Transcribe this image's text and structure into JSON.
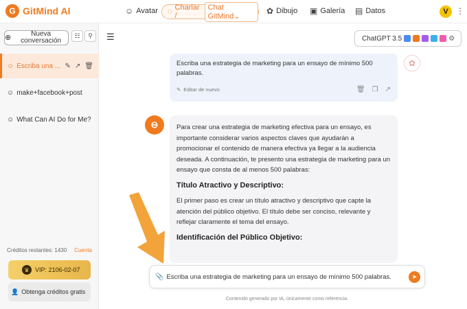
{
  "app": {
    "name": "GitMind AI",
    "logo_letter": "G"
  },
  "nav": {
    "avatar": "Avatar",
    "chat": "Charlar /",
    "chat_sub": "Chat GitMind",
    "drawing": "Dibujo",
    "gallery": "Galería",
    "data": "Datos",
    "user_initial": "V"
  },
  "sidebar": {
    "new_conversation": "Nueva conversación",
    "conversations": [
      {
        "title": "Escriba una ...",
        "active": true
      },
      {
        "title": "make+facebook+post",
        "active": false
      },
      {
        "title": "What Can AI Do for Me?",
        "active": false
      }
    ],
    "credits_label": "Créditos restantes: 1430",
    "account_link": "Cuenta",
    "vip": "VIP: 2106-02-07",
    "free_credits": "Obtenga créditos gratis"
  },
  "header": {
    "model": "ChatGPT 3.5",
    "model_icon_colors": [
      "#4a8df0",
      "#f07a1f",
      "#a45cf0",
      "#3ab0f0",
      "#f05cae"
    ]
  },
  "user_message": {
    "text": "Escriba una estrategia de marketing para un ensayo de mínimo 500 palabras.",
    "edit_label": "Editar de nuevo"
  },
  "bot_message": {
    "p1": "Para crear una estrategia de marketing efectiva para un ensayo, es importante considerar varios aspectos claves que ayudarán a promocionar el contenido de manera efectiva ya llegar a la audiencia deseada. A continuación, te presento una estrategia de marketing para un ensayo que consta de al menos 500 palabras:",
    "h1": "Título Atractivo y Descriptivo:",
    "p2": "El primer paso es crear un título atractivo y descriptivo que capte la atención del público objetivo. El título debe ser conciso, relevante y reflejar claramente el tema del ensayo.",
    "h2": "Identificación del Público Objetivo:"
  },
  "input": {
    "value": "Escriba una estrategia de marketing para un ensayo de mínimo 500 palabras."
  },
  "disclaimer": "Contenido generado por IA, únicamente como referencia.",
  "colors": {
    "brand": "#f07a1f",
    "arrow": "#f2a33a"
  }
}
